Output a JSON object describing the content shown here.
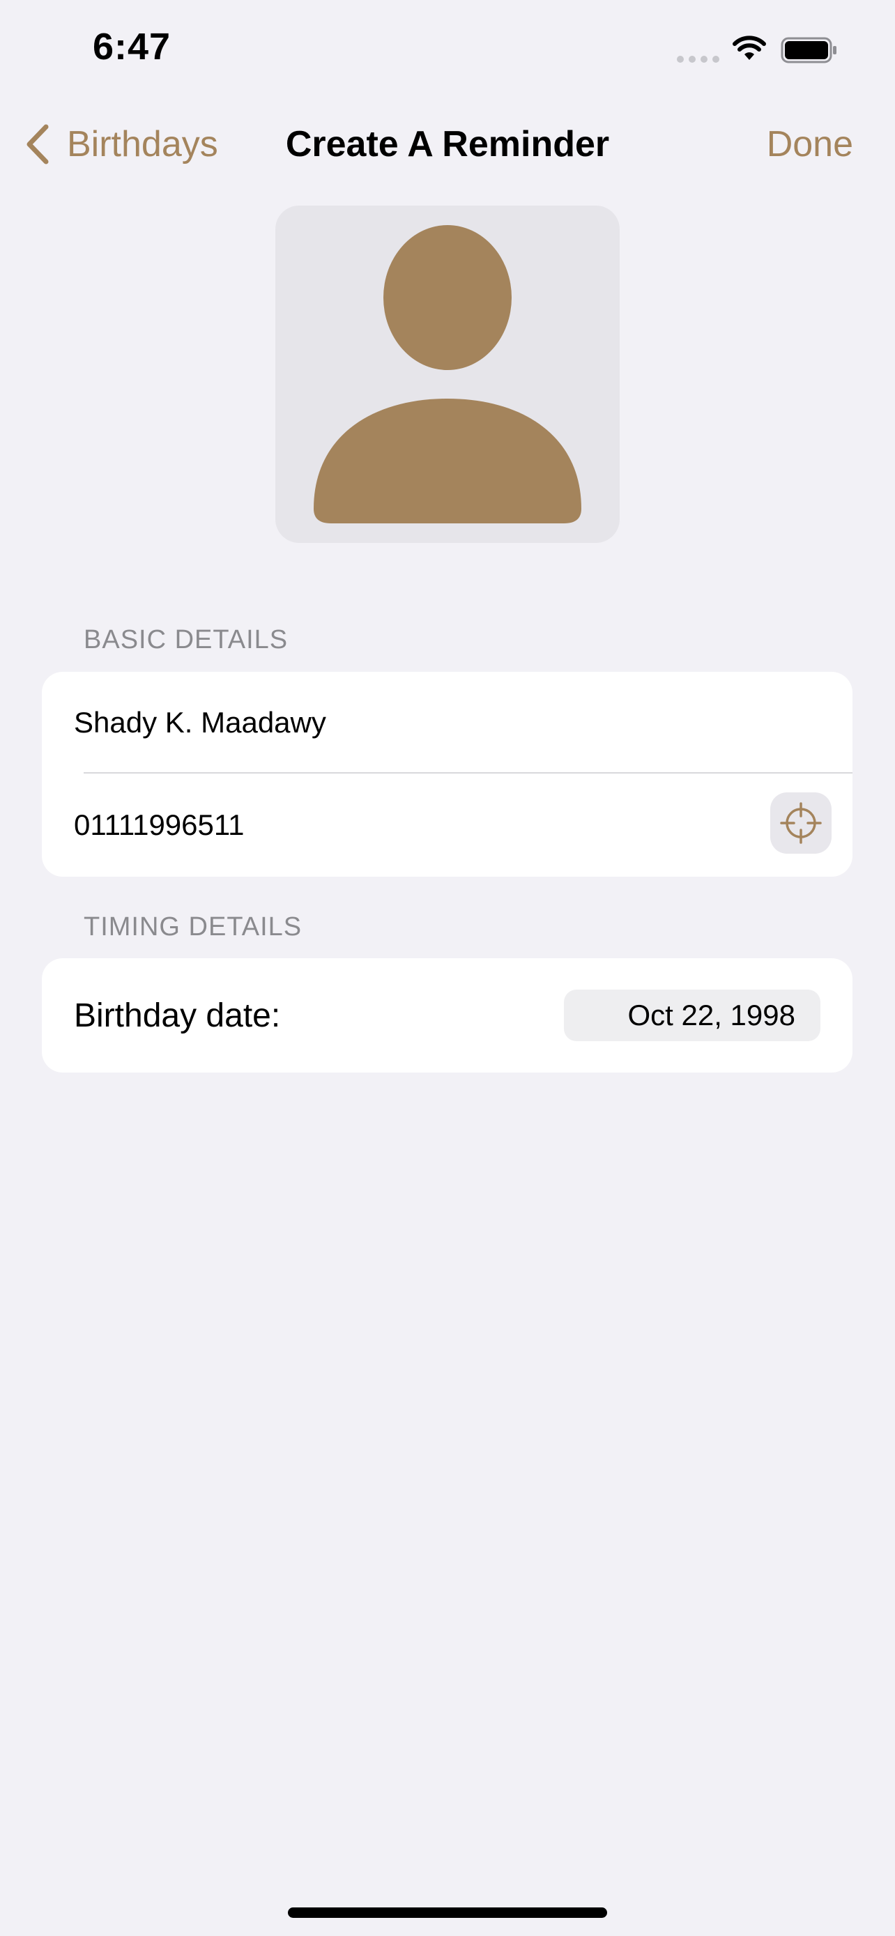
{
  "status_bar": {
    "time": "6:47"
  },
  "nav": {
    "back_label": "Birthdays",
    "title": "Create A Reminder",
    "done_label": "Done"
  },
  "avatar": {
    "icon": "person-silhouette-icon"
  },
  "basic_details": {
    "header": "BASIC DETAILS",
    "name_value": "Shady K. Maadawy",
    "phone_value": "01111996511",
    "locate_icon": "crosshair-icon"
  },
  "timing_details": {
    "header": "TIMING DETAILS",
    "birthday_label": "Birthday date:",
    "birthday_value": "Oct 22, 1998"
  },
  "colors": {
    "accent": "#a4845c",
    "background": "#f2f1f6",
    "avatar_bg": "#e6e5ea"
  }
}
